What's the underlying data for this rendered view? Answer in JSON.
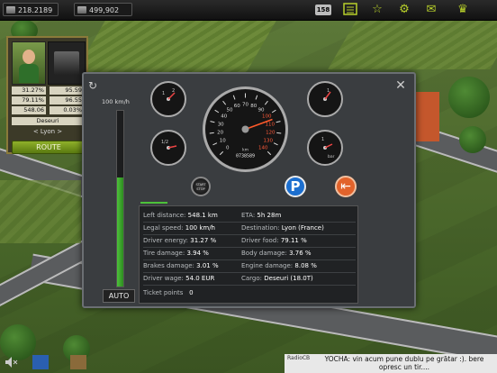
{
  "topbar": {
    "stat1": "218.2189",
    "stat2": "499,902",
    "badge": "158",
    "icons": [
      "list-icon",
      "star-icon",
      "gear-icon",
      "mail-icon",
      "crown-icon"
    ]
  },
  "driver_card": {
    "stats": [
      "31.27%",
      "95.59",
      "79.11%",
      "96.55",
      "548.06",
      "0.03%"
    ],
    "cargo": "Deseuri",
    "destination": "< Lyon >",
    "route_label": "ROUTE"
  },
  "dialog": {
    "speed_max_label": "100 km/h",
    "speed_fill_fraction": 0.62,
    "auto_label": "AUTO",
    "speedometer": {
      "ticks": [
        "0",
        "10",
        "20",
        "30",
        "40",
        "50",
        "60",
        "70",
        "80",
        "90",
        "100",
        "110",
        "120",
        "130",
        "140"
      ],
      "unit": "km",
      "odometer": "0738589"
    },
    "small_gauges": {
      "top_left_ticks": [
        "1",
        "2"
      ],
      "mid_left_ticks": [
        "1/2"
      ],
      "right_top_ticks": [
        "1"
      ],
      "right_mid_ticks": [
        "1",
        "bar"
      ]
    },
    "start_stop": "START\nSTOP",
    "parking": "P",
    "info": {
      "left_distance_label": "Left distance:",
      "left_distance": "548.1 km",
      "eta_label": "ETA:",
      "eta": "5h 28m",
      "legal_speed_label": "Legal speed:",
      "legal_speed": "100 km/h",
      "destination_label": "Destination:",
      "destination": "Lyon (France)",
      "driver_energy_label": "Driver energy:",
      "driver_energy": "31.27 %",
      "driver_food_label": "Driver food:",
      "driver_food": "79.11 %",
      "tire_damage_label": "Tire damage:",
      "tire_damage": "3.94 %",
      "body_damage_label": "Body damage:",
      "body_damage": "3.76 %",
      "brakes_damage_label": "Brakes damage:",
      "brakes_damage": "3.01 %",
      "engine_damage_label": "Engine damage:",
      "engine_damage": "8.08 %",
      "driver_wage_label": "Driver wage:",
      "driver_wage": "54.0 EUR",
      "cargo_label": "Cargo:",
      "cargo": "Deseuri (18.0T)",
      "ticket_points_label": "Ticket points",
      "ticket_points": "0"
    }
  },
  "chat": {
    "channel": "RadioCB",
    "message": "YOCHA: vin acum pune dublu pe grătar :). bere opresc un tir...."
  },
  "colors": {
    "accent_green": "#8fb02a",
    "speed_green": "#4cc23a",
    "parking_blue": "#1c6fcf",
    "exit_orange": "#e2632b"
  }
}
